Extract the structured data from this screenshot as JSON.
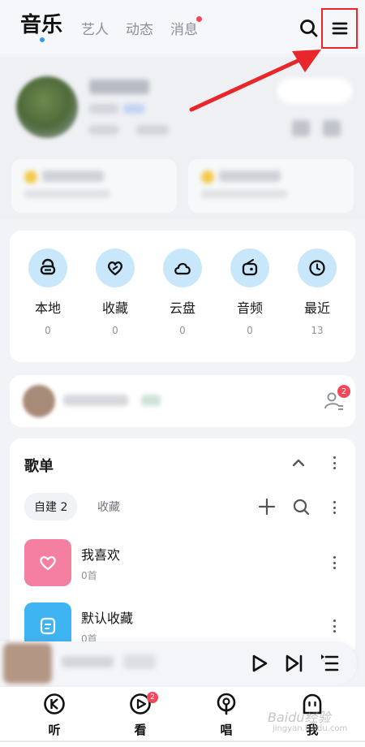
{
  "header": {
    "tabs": [
      {
        "label": "音乐",
        "active": true
      },
      {
        "label": "艺人"
      },
      {
        "label": "动态"
      },
      {
        "label": "消息",
        "has_dot": true
      }
    ]
  },
  "quick_access": [
    {
      "label": "本地",
      "count": "0",
      "icon": "local-music-icon"
    },
    {
      "label": "收藏",
      "count": "0",
      "icon": "heart-collect-icon"
    },
    {
      "label": "云盘",
      "count": "0",
      "icon": "cloud-disk-icon"
    },
    {
      "label": "音频",
      "count": "0",
      "icon": "audio-icon"
    },
    {
      "label": "最近",
      "count": "13",
      "icon": "clock-icon"
    }
  ],
  "friend_bar": {
    "badge": "2"
  },
  "playlists": {
    "title": "歌单",
    "tabs": [
      {
        "label": "自建 2",
        "active": true
      },
      {
        "label": "收藏"
      }
    ],
    "items": [
      {
        "name": "我喜欢",
        "count": "0首",
        "color": "#f57fa0",
        "icon": "heart-icon"
      },
      {
        "name": "默认收藏",
        "count": "0首",
        "color": "#3fb4f2",
        "icon": "note-icon"
      }
    ]
  },
  "bottom_nav": [
    {
      "label": "听",
      "icon": "listen-icon"
    },
    {
      "label": "看",
      "icon": "watch-icon",
      "badge": "2"
    },
    {
      "label": "唱",
      "icon": "sing-icon"
    },
    {
      "label": "我",
      "icon": "me-icon"
    }
  ],
  "watermark": {
    "text": "Baidu经验",
    "sub": "jingyan.baidu.com"
  },
  "colors": {
    "accent_blue": "#2f9bf2",
    "badge_red": "#f2475a",
    "highlight_red": "#e8262b",
    "icon_circle": "#c9e7fb"
  }
}
